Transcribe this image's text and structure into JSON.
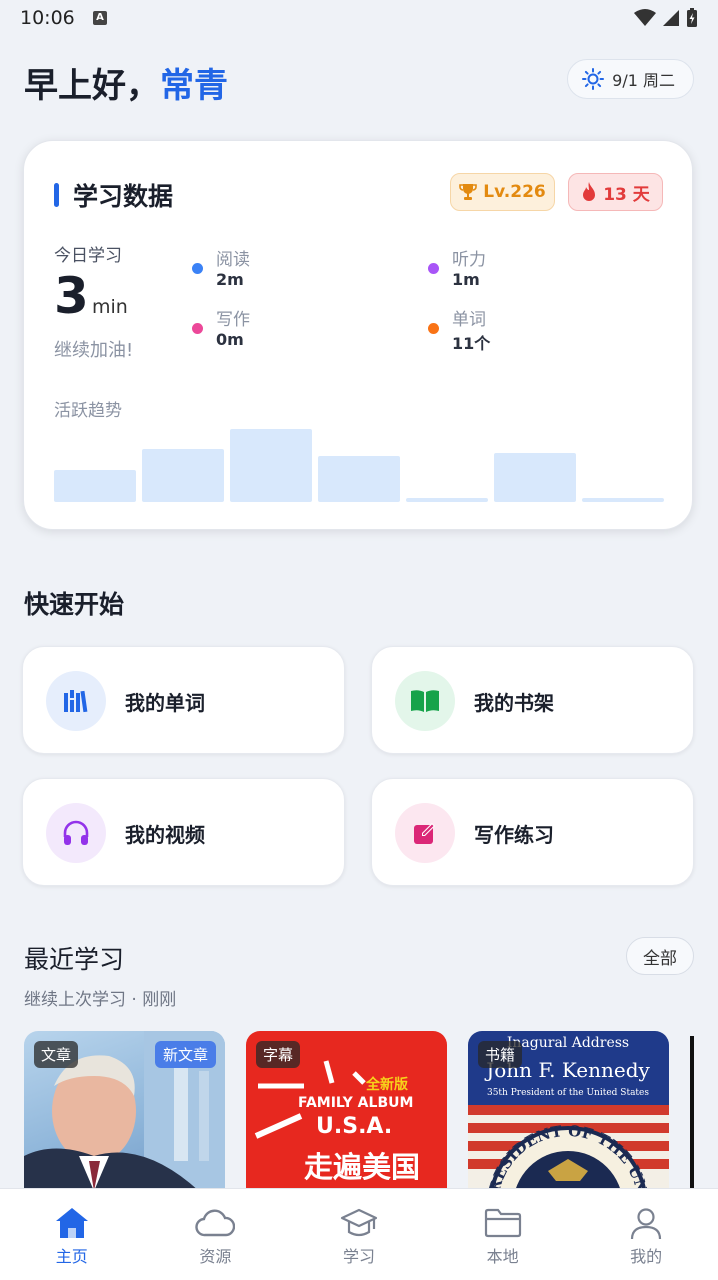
{
  "status_bar": {
    "time": "10:06",
    "a_icon": "A"
  },
  "header": {
    "greeting": "早上好，",
    "name": "常青",
    "date": "9/1 周二",
    "date_icon": "sun-icon"
  },
  "study_card": {
    "title": "学习数据",
    "level": "Lv.226",
    "streak": "13 天",
    "today_label": "今日学习",
    "today_value": "3",
    "today_unit": "min",
    "cheer": "继续加油!",
    "stats": [
      {
        "label": "阅读",
        "value": "2m",
        "color": "#3b82f6"
      },
      {
        "label": "听力",
        "value": "1m",
        "color": "#a855f7"
      },
      {
        "label": "写作",
        "value": "0m",
        "color": "#ec4899"
      },
      {
        "label": "单词",
        "value": "11个",
        "color": "#f97316"
      }
    ],
    "trend_label": "活跃趋势",
    "trend_levels": [
      0.4,
      0.65,
      0.9,
      0.57,
      0.05,
      0.6,
      0.05
    ]
  },
  "quick_start": {
    "title": "快速开始",
    "items": [
      {
        "label": "我的单词",
        "icon": "books-icon",
        "bg": "#e6eefc",
        "color": "#2266e6"
      },
      {
        "label": "我的书架",
        "icon": "book-open-icon",
        "bg": "#e3f6ea",
        "color": "#16a34a"
      },
      {
        "label": "我的视频",
        "icon": "headphones-icon",
        "bg": "#f3e9fc",
        "color": "#9333ea"
      },
      {
        "label": "写作练习",
        "icon": "edit-icon",
        "bg": "#fce7f0",
        "color": "#db2777"
      }
    ]
  },
  "recent": {
    "title": "最近学习",
    "subtitle": "继续上次学习 · 刚刚",
    "all_label": "全部",
    "items": [
      {
        "tag": "文章",
        "new_tag": "新文章"
      },
      {
        "tag": "字幕",
        "cover_text_1": "全新版",
        "cover_text_2": "FAMILY ALBUM",
        "cover_text_3": "U.S.A.",
        "cover_text_4": "走遍美国"
      },
      {
        "tag": "书籍",
        "cover_text_1": "Inagural Address",
        "cover_text_2": "John F. Kennedy",
        "cover_text_3": "35th President of the United States",
        "cover_text_4": "PRESIDENT OF THE UNIT"
      }
    ]
  },
  "nav": [
    {
      "label": "主页",
      "icon": "home-icon",
      "active": true
    },
    {
      "label": "资源",
      "icon": "cloud-icon"
    },
    {
      "label": "学习",
      "icon": "graduation-cap-icon"
    },
    {
      "label": "本地",
      "icon": "folder-icon"
    },
    {
      "label": "我的",
      "icon": "user-icon"
    }
  ],
  "colors": {
    "accent": "#2266e6",
    "background": "#eff2f7"
  }
}
